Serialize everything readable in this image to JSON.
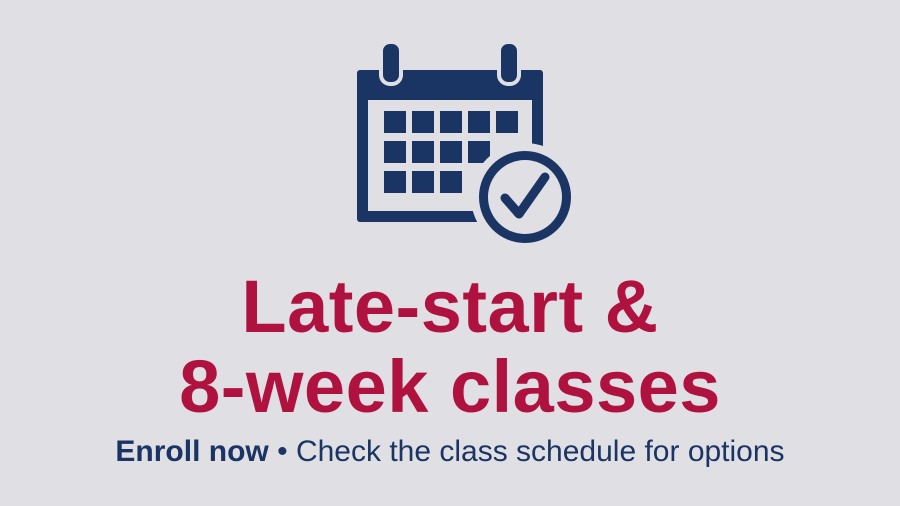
{
  "colors": {
    "background": "#e0dfe4",
    "navy": "#1a3564",
    "crimson": "#b0123f"
  },
  "icon": {
    "name": "calendar-check-icon"
  },
  "headline": {
    "line1": "Late-start &",
    "line2": "8-week classes"
  },
  "subline": {
    "cta": "Enroll now",
    "separator": "•",
    "detail": "Check the class schedule for options"
  }
}
